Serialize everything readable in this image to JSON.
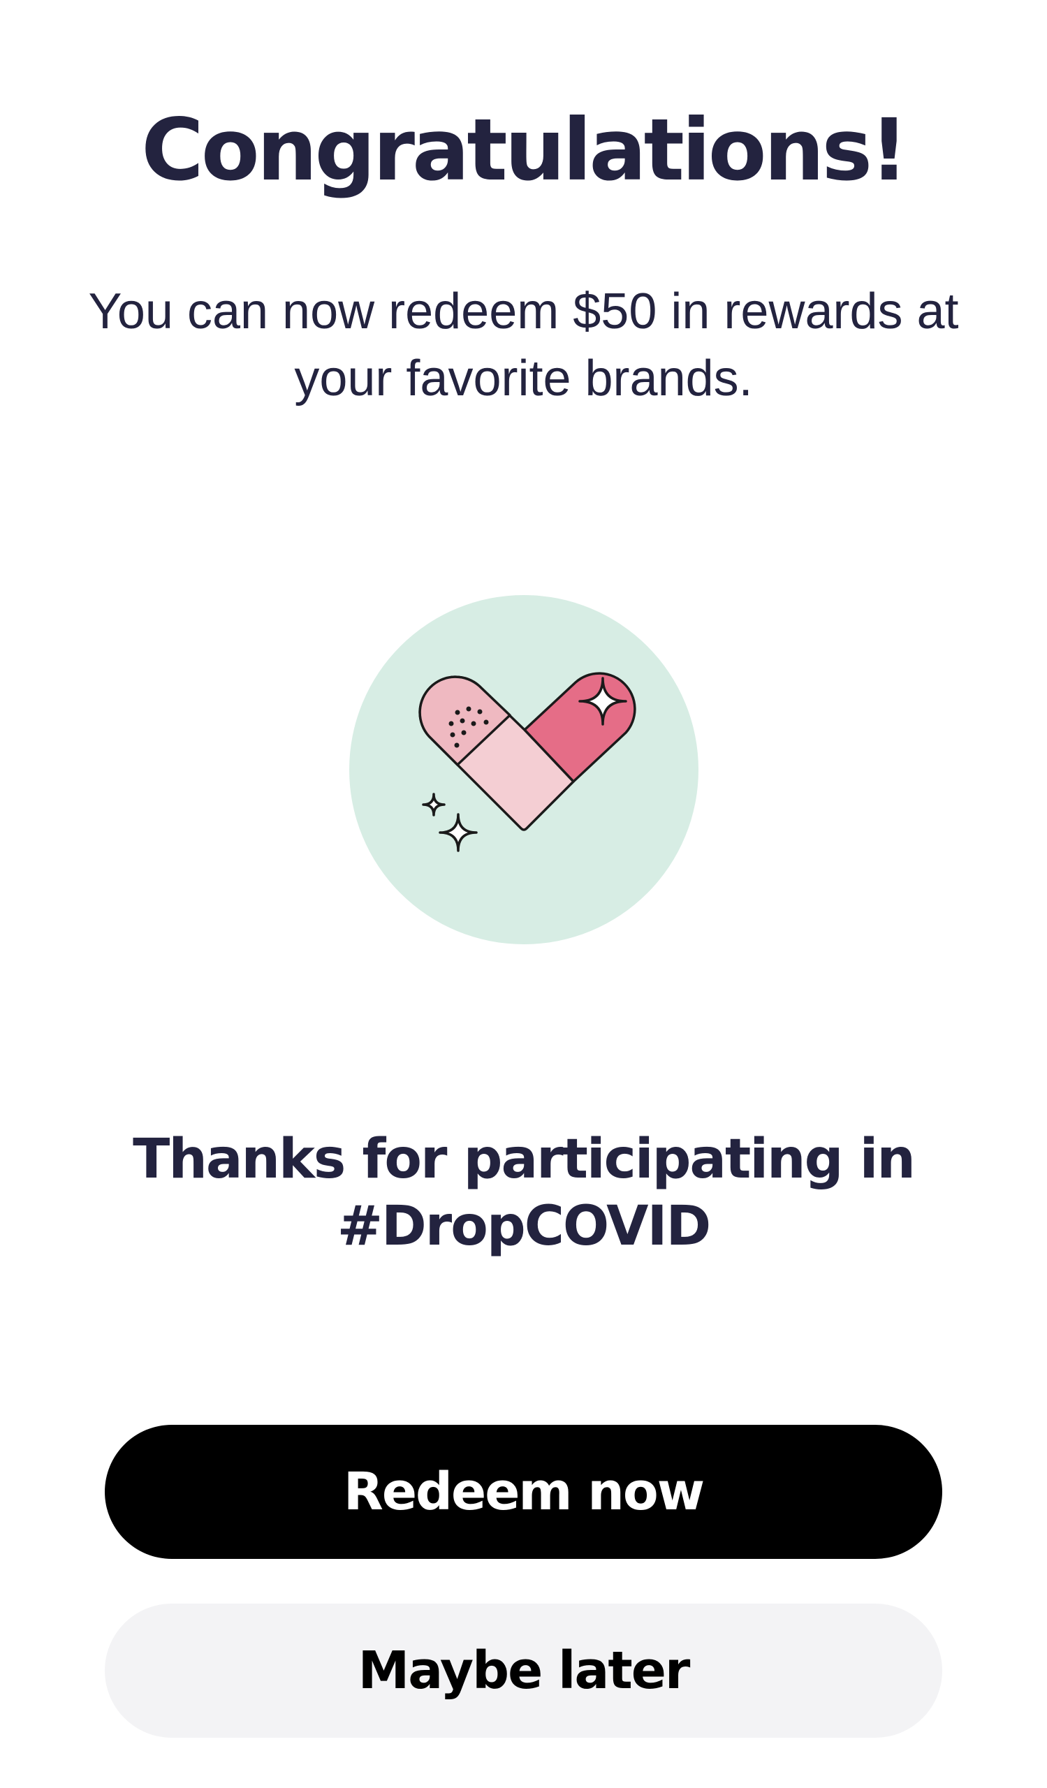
{
  "header": {
    "title": "Congratulations!",
    "subtitle": "You can now redeem $50 in rewards at your favorite brands."
  },
  "illustration": {
    "icon": "heart-bandage-icon",
    "circle_color": "#d7ede4",
    "pink_light": "#f4ced3",
    "pink_dark": "#e56d87"
  },
  "message": {
    "thanks": "Thanks for participating in #DropCOVID"
  },
  "actions": {
    "primary_label": "Redeem now",
    "secondary_label": "Maybe later"
  }
}
